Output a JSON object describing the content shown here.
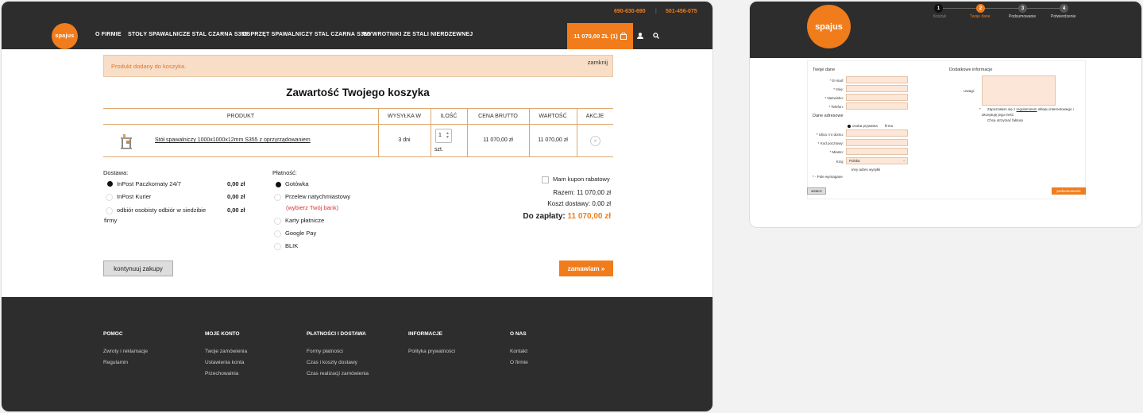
{
  "header": {
    "phone1": "690-630-690",
    "phone_sep": "|",
    "phone2": "501-456-075",
    "logo": "spajus",
    "nav": [
      "O FIRMIE",
      "STOŁY SPAWALNICZE STAL CZARNA S355",
      "OSPRZĘT SPAWALNICZY STAL CZARNA S355",
      "WYWROTNIKI ZE STALI NIERDZEWNEJ"
    ],
    "cart_label": "11 070,00 ZŁ (1)",
    "cart_icon": "shopping-bag-icon",
    "user_icon": "user-icon",
    "search_icon": "search-icon"
  },
  "alert": {
    "message": "Produkt dodany do koszyka.",
    "close": "zamknij"
  },
  "cart": {
    "title": "Zawartość Twojego koszyka",
    "columns": [
      "PRODUKT",
      "WYSYŁKA W",
      "ILOŚĆ",
      "CENA BRUTTO",
      "WARTOŚĆ",
      "AKCJE"
    ],
    "row": {
      "product": "Stół spawalniczy 1000x1000x12mm S355 z oprzyrządowaniem",
      "shipping": "3 dni",
      "qty": "1",
      "unit": "szt.",
      "price": "11 070,00 zł",
      "value": "11 070,00 zł"
    }
  },
  "delivery": {
    "title": "Dostawa:",
    "options": [
      {
        "label": "InPost Paczkomaty 24/7",
        "price": "0,00 zł"
      },
      {
        "label": "InPost Kurier",
        "price": "0,00 zł"
      },
      {
        "label": "odbiór osobisty odbiór w siedzibie",
        "label2": "firmy",
        "price": "0,00 zł"
      }
    ]
  },
  "payment": {
    "title": "Płatność:",
    "options": [
      "Gotówka",
      "Przelew natychmiastowy",
      "Karty płatnicze",
      "Google Pay",
      "BLIK"
    ],
    "bank_link": "(wybierz Twój bank)"
  },
  "summary": {
    "coupon": "Mam kupon rabatowy",
    "subtotal": "Razem: 11 070,00 zł",
    "shipping": "Koszt dostawy: 0,00 zł",
    "total_label": "Do zapłaty:",
    "total_value": "11 070,00 zł"
  },
  "buttons": {
    "continue": "kontynuuj zakupy",
    "order": "zamawiam »"
  },
  "footer": {
    "cols": [
      {
        "title": "POMOC",
        "links": [
          "Zwroty i reklamacje",
          "Regulamin"
        ]
      },
      {
        "title": "MOJE KONTO",
        "links": [
          "Twoje zamówienia",
          "Ustawienia konta",
          "Przechowalnia"
        ]
      },
      {
        "title": "PŁATNOŚCI I DOSTAWA",
        "links": [
          "Formy płatności",
          "Czas i koszty dostawy",
          "Czas realizacji zamówienia"
        ]
      },
      {
        "title": "INFORMACJE",
        "links": [
          "Polityka prywatności"
        ]
      },
      {
        "title": "O NAS",
        "links": [
          "Kontakt",
          "O firmie"
        ]
      }
    ]
  },
  "checkout": {
    "logo": "spajus",
    "steps": [
      {
        "num": "1",
        "label": "Koszyk"
      },
      {
        "num": "2",
        "label": "Twoje dane"
      },
      {
        "num": "3",
        "label": "Podsumowanie"
      },
      {
        "num": "4",
        "label": "Potwierdzenie"
      }
    ],
    "your_data": "Twoje dane",
    "fields": [
      "* E-mail:",
      "* Imię:",
      "* Nazwisko:",
      "* Telefon:"
    ],
    "address_title": "Dane adresowe",
    "address_type": [
      "osoba prywatna",
      "firma"
    ],
    "address_fields": [
      "* Ulica i nr domu:",
      "* Kod pocztowy:",
      "* Miasto:",
      "Kraj:"
    ],
    "country": "Polska",
    "other_address": "inny adres wysyłki",
    "required": "* - Pole wymagane",
    "extra_title": "Dodatkowe informacje",
    "notes": "Uwagi:",
    "terms_prefix": "Zapoznałem się z",
    "terms_link": "regulaminem",
    "terms_suffix": "sklepu internetowego i",
    "terms_line2": "akceptuję jego treść.",
    "keyboard": "Chcę otrzymać fakturę",
    "back": "wstecz",
    "next": "podsumowanie"
  }
}
